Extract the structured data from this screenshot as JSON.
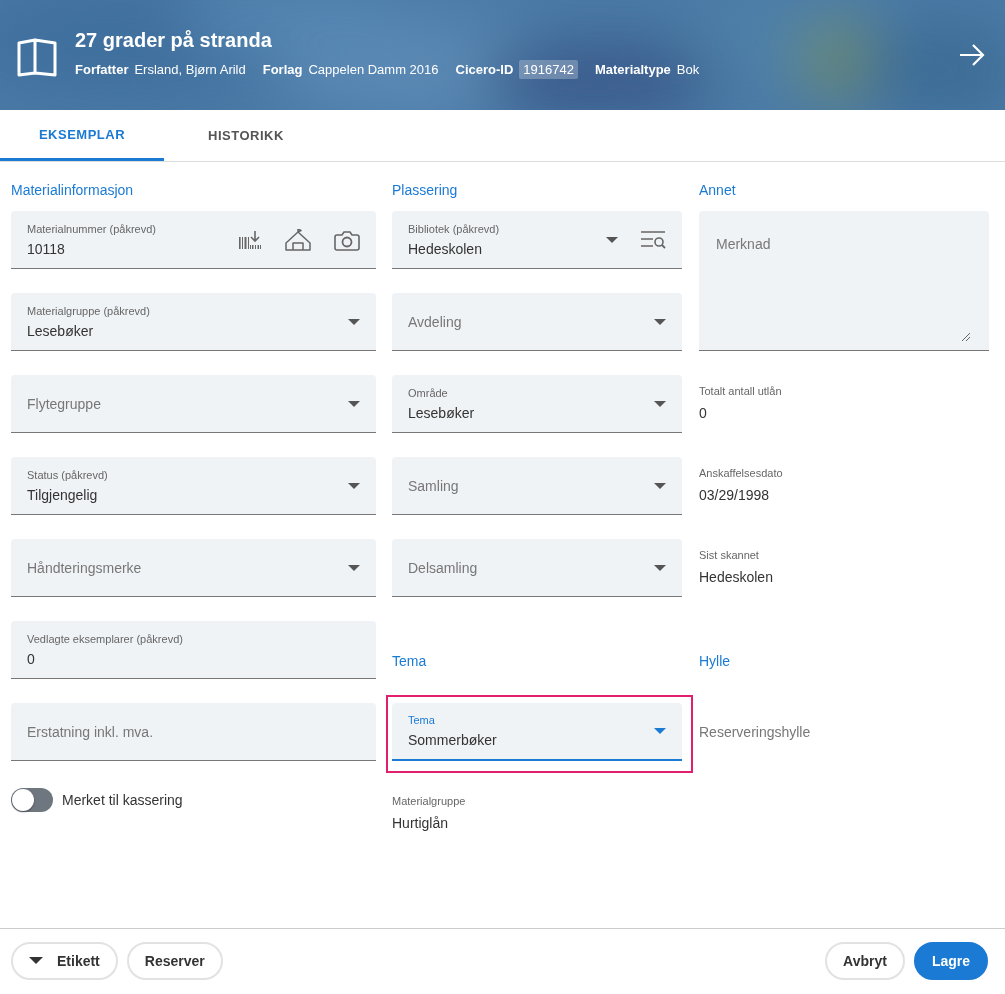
{
  "header": {
    "title": "27 grader på stranda",
    "meta": [
      {
        "label": "Forfatter",
        "value": "Ersland, Bjørn Arild",
        "badge": false
      },
      {
        "label": "Forlag",
        "value": "Cappelen Damm 2016",
        "badge": false
      },
      {
        "label": "Cicero-ID",
        "value": "1916742",
        "badge": true
      },
      {
        "label": "Materialtype",
        "value": "Bok",
        "badge": false
      }
    ]
  },
  "tabs": [
    {
      "label": "EKSEMPLAR",
      "selected": true
    },
    {
      "label": "HISTORIKK",
      "selected": false
    }
  ],
  "columns": [
    {
      "title": "Materialinformasjon",
      "items": [
        {
          "kind": "scan",
          "label": "Materialnummer (påkrevd)",
          "value": "10118"
        },
        {
          "kind": "select",
          "label": "Materialgruppe (påkrevd)",
          "value": "Lesebøker"
        },
        {
          "kind": "select",
          "placeholder": "Flytegruppe"
        },
        {
          "kind": "select",
          "label": "Status (påkrevd)",
          "value": "Tilgjengelig"
        },
        {
          "kind": "select",
          "placeholder": "Håndteringsmerke"
        },
        {
          "kind": "text",
          "label": "Vedlagte eksemplarer (påkrevd)",
          "value": "0"
        },
        {
          "kind": "text",
          "placeholder": "Erstatning inkl. mva."
        },
        {
          "kind": "toggle",
          "label": "Merket til kassering",
          "on": false
        }
      ]
    },
    {
      "title": "Plassering",
      "items": [
        {
          "kind": "select-search",
          "label": "Bibliotek (påkrevd)",
          "value": "Hedeskolen"
        },
        {
          "kind": "select",
          "placeholder": "Avdeling"
        },
        {
          "kind": "select",
          "label": "Område",
          "value": "Lesebøker"
        },
        {
          "kind": "select",
          "placeholder": "Samling"
        },
        {
          "kind": "select",
          "placeholder": "Delsamling"
        },
        {
          "kind": "heading",
          "text": "Tema"
        },
        {
          "kind": "select",
          "label": "Tema",
          "value": "Sommerbøker",
          "focused": true,
          "highlighted": true
        },
        {
          "kind": "readonly",
          "label": "Materialgruppe",
          "value": "Hurtiglån"
        }
      ]
    },
    {
      "title": "Annet",
      "items": [
        {
          "kind": "textarea",
          "placeholder": "Merknad"
        },
        {
          "kind": "readonly",
          "label": "Totalt antall utlån",
          "value": "0"
        },
        {
          "kind": "readonly",
          "label": "Anskaffelsesdato",
          "value": "03/29/1998"
        },
        {
          "kind": "readonly",
          "label": "Sist skannet",
          "value": "Hedeskolen"
        },
        {
          "kind": "heading",
          "text": "Hylle"
        },
        {
          "kind": "plain",
          "text": "Reserveringshylle"
        }
      ]
    }
  ],
  "footer": {
    "left": [
      {
        "label": "Etikett",
        "menu": true,
        "primary": false
      },
      {
        "label": "Reserver",
        "menu": false,
        "primary": false
      }
    ],
    "right": [
      {
        "label": "Avbryt",
        "menu": false,
        "primary": false
      },
      {
        "label": "Lagre",
        "menu": false,
        "primary": true
      }
    ]
  }
}
